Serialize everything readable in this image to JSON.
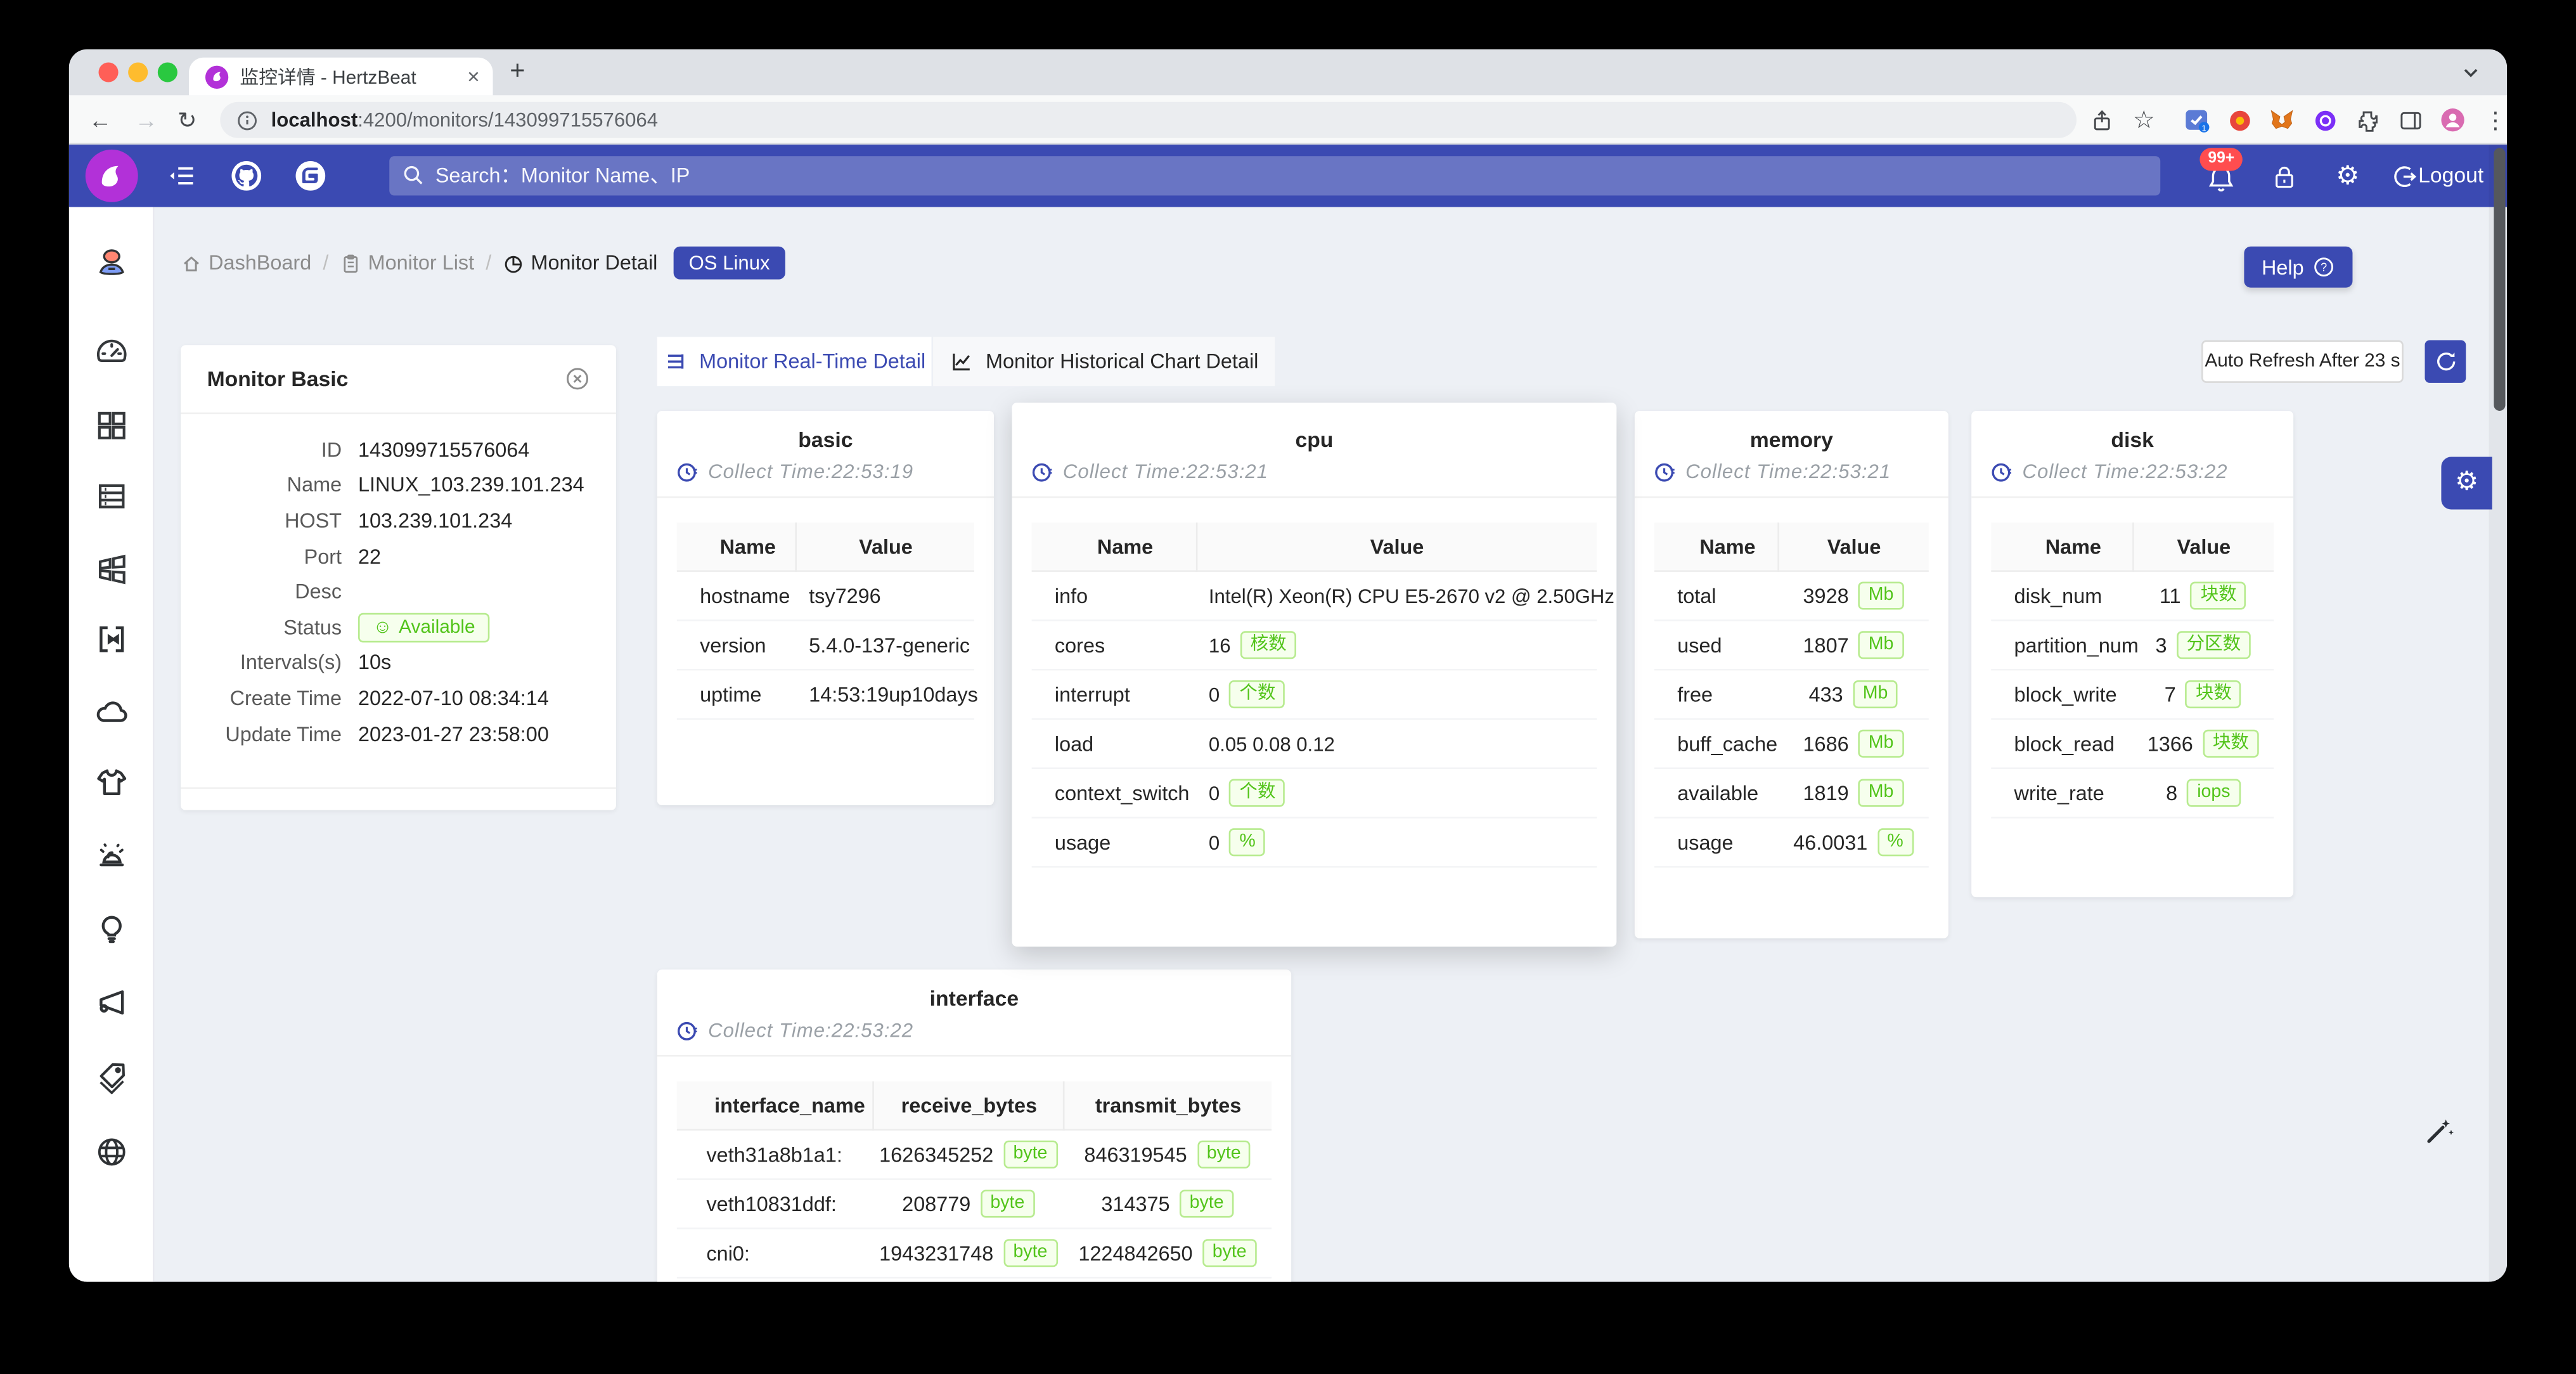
{
  "browser": {
    "tab_title": "监控详情 - HertzBeat",
    "url_host": "localhost",
    "url_rest": ":4200/monitors/143099715576064",
    "new_tab_glyph": "+",
    "tab_close_glyph": "×",
    "menu_dots_glyph": "⋮",
    "star_glyph": "☆"
  },
  "topnav": {
    "search_placeholder": "Search：Monitor Name、IP",
    "notification_badge": "99+",
    "logout_label": "Logout"
  },
  "page": {
    "breadcrumb": [
      "DashBoard",
      "Monitor List",
      "Monitor Detail"
    ],
    "monitor_type_badge": "OS Linux",
    "help_label": "Help",
    "tab_realtime": "Monitor Real-Time Detail",
    "tab_historical": "Monitor Historical Chart Detail",
    "auto_refresh_label": "Auto Refresh After 23 s"
  },
  "monitor_basic": {
    "title": "Monitor Basic",
    "fields": [
      {
        "label": "ID",
        "value": "143099715576064"
      },
      {
        "label": "Name",
        "value": "LINUX_103.239.101.234"
      },
      {
        "label": "HOST",
        "value": "103.239.101.234"
      },
      {
        "label": "Port",
        "value": "22"
      },
      {
        "label": "Desc",
        "value": ""
      },
      {
        "label": "Status",
        "pill": "Available"
      },
      {
        "label": "Intervals(s)",
        "value": "10s"
      },
      {
        "label": "Create Time",
        "value": "2022-07-10 08:34:14"
      },
      {
        "label": "Update Time",
        "value": "2023-01-27 23:58:00"
      }
    ]
  },
  "metric_cards": [
    {
      "title": "basic",
      "collect_time": "Collect Time:22:53:19",
      "columns": [
        "Name",
        "Value"
      ],
      "rows": [
        {
          "name": "hostname",
          "value": "tsy7296"
        },
        {
          "name": "version",
          "value": "5.4.0-137-generic"
        },
        {
          "name": "uptime",
          "value": "14:53:19up10days"
        }
      ]
    },
    {
      "title": "cpu",
      "collect_time": "Collect Time:22:53:21",
      "columns": [
        "Name",
        "Value"
      ],
      "rows": [
        {
          "name": "info",
          "value": "Intel(R) Xeon(R) CPU E5-2670 v2 @ 2.50GHz"
        },
        {
          "name": "cores",
          "value": "16",
          "tag": "核数"
        },
        {
          "name": "interrupt",
          "value": "0",
          "tag": "个数"
        },
        {
          "name": "load",
          "value": "0.05 0.08 0.12"
        },
        {
          "name": "context_switch",
          "value": "0",
          "tag": "个数"
        },
        {
          "name": "usage",
          "value": "0",
          "tag": "%"
        }
      ]
    },
    {
      "title": "memory",
      "collect_time": "Collect Time:22:53:21",
      "columns": [
        "Name",
        "Value"
      ],
      "rows": [
        {
          "name": "total",
          "value": "3928",
          "tag": "Mb"
        },
        {
          "name": "used",
          "value": "1807",
          "tag": "Mb"
        },
        {
          "name": "free",
          "value": "433",
          "tag": "Mb"
        },
        {
          "name": "buff_cache",
          "value": "1686",
          "tag": "Mb"
        },
        {
          "name": "available",
          "value": "1819",
          "tag": "Mb"
        },
        {
          "name": "usage",
          "value": "46.0031",
          "tag": "%"
        }
      ]
    },
    {
      "title": "disk",
      "collect_time": "Collect Time:22:53:22",
      "columns": [
        "Name",
        "Value"
      ],
      "rows": [
        {
          "name": "disk_num",
          "value": "11",
          "tag": "块数"
        },
        {
          "name": "partition_num",
          "value": "3",
          "tag": "分区数"
        },
        {
          "name": "block_write",
          "value": "7",
          "tag": "块数"
        },
        {
          "name": "block_read",
          "value": "1366",
          "tag": "块数"
        },
        {
          "name": "write_rate",
          "value": "8",
          "tag": "iops"
        }
      ]
    }
  ],
  "interface_card": {
    "title": "interface",
    "collect_time": "Collect Time:22:53:22",
    "columns": [
      "interface_name",
      "receive_bytes",
      "transmit_bytes"
    ],
    "rows": [
      {
        "name": "veth31a8b1a1:",
        "rx": "1626345252",
        "rx_tag": "byte",
        "tx": "846319545",
        "tx_tag": "byte"
      },
      {
        "name": "veth10831ddf:",
        "rx": "208779",
        "rx_tag": "byte",
        "tx": "314375",
        "tx_tag": "byte"
      },
      {
        "name": "cni0:",
        "rx": "1943231748",
        "rx_tag": "byte",
        "tx": "1224842650",
        "tx_tag": "byte"
      }
    ]
  },
  "sidebar_icons": [
    "user-avatar",
    "dashboard-gauge",
    "apps-grid",
    "server-stack",
    "app-windows",
    "merge-brackets",
    "cloud",
    "tshirt",
    "alert-siren",
    "bulb",
    "megaphone",
    "tags",
    "globe"
  ],
  "colors": {
    "accent_indigo": "#3b4ab2",
    "logo_purple": "#b231d8",
    "tag_green_text": "#52c41a",
    "tag_green_bg": "#f6ffed",
    "tag_green_border": "#b7eb8f",
    "badge_red": "#ff4d4f",
    "traffic_red": "#ff5f57",
    "traffic_yellow": "#febc2e",
    "traffic_green": "#2ac840"
  }
}
